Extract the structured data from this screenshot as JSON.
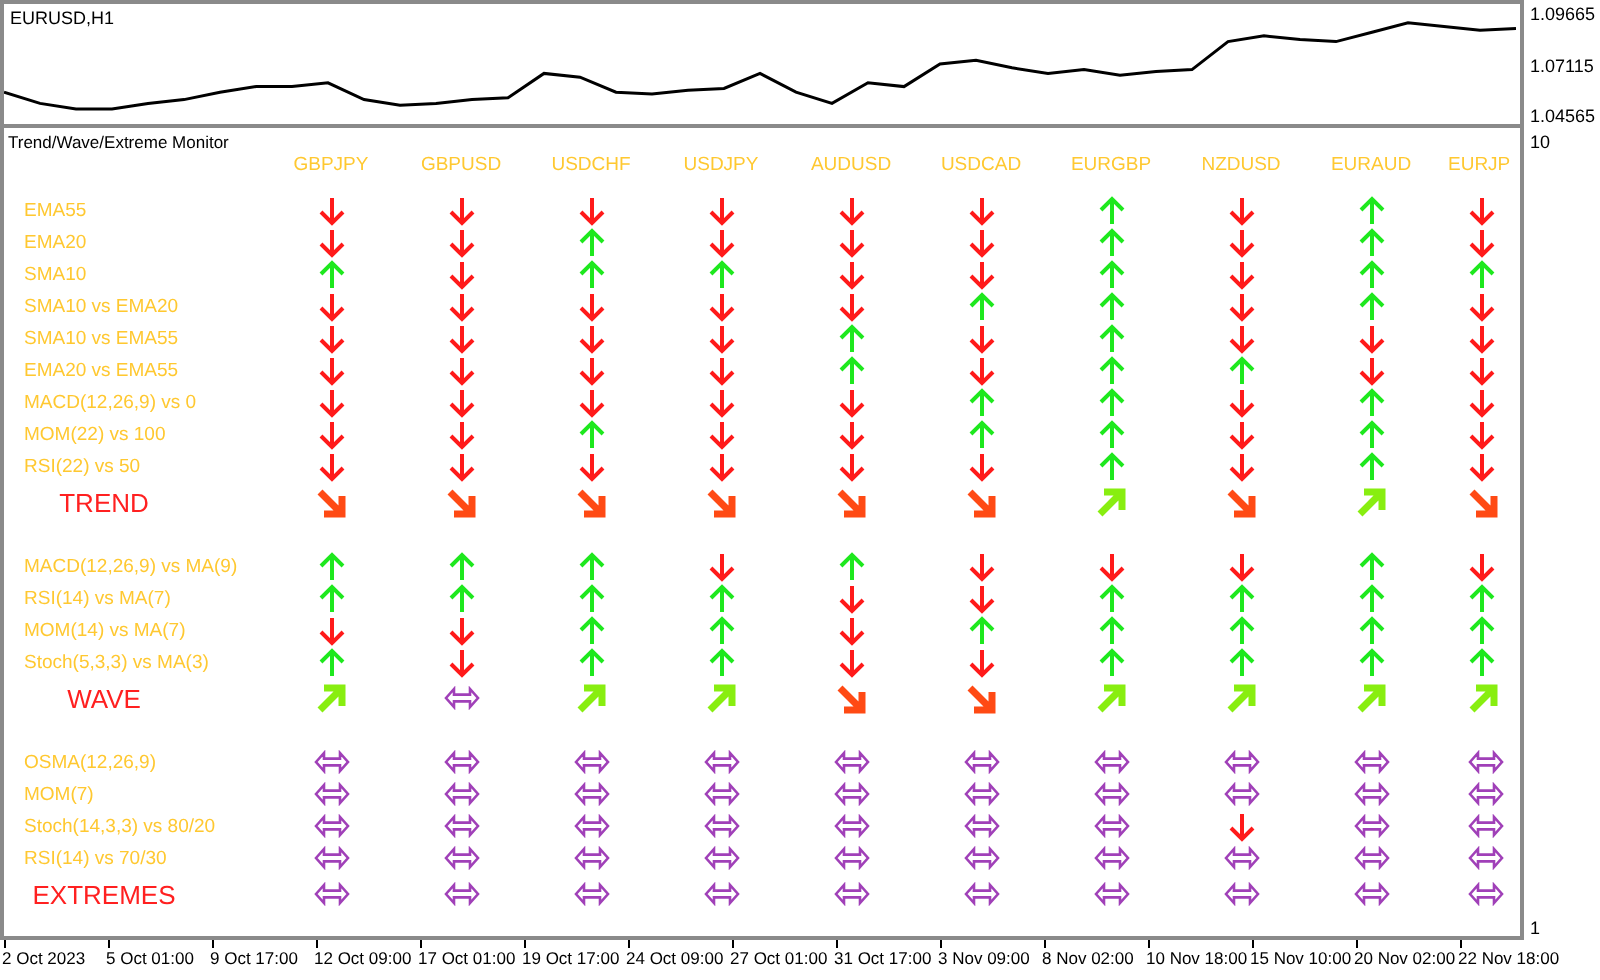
{
  "chart": {
    "title": "EURUSD,H1",
    "chart_data": {
      "type": "line",
      "ylim": [
        1.04,
        1.104
      ],
      "yticks": [
        1.09665,
        1.07115,
        1.04565
      ],
      "series": [
        {
          "color": "#000000",
          "values": [
            1.057,
            1.051,
            1.048,
            1.048,
            1.051,
            1.053,
            1.057,
            1.06,
            1.06,
            1.062,
            1.053,
            1.05,
            1.051,
            1.053,
            1.054,
            1.067,
            1.065,
            1.057,
            1.056,
            1.058,
            1.059,
            1.067,
            1.057,
            1.051,
            1.062,
            1.06,
            1.072,
            1.074,
            1.07,
            1.067,
            1.069,
            1.066,
            1.068,
            1.069,
            1.084,
            1.087,
            1.085,
            1.084,
            1.089,
            1.094,
            1.092,
            1.09,
            1.091
          ]
        }
      ]
    }
  },
  "monitor": {
    "title": "Trend/Wave/Extreme Monitor",
    "scale_labels": [
      "10",
      "1"
    ],
    "symbols": [
      "GBPJPY",
      "GBPUSD",
      "USDCHF",
      "USDJPY",
      "AUDUSD",
      "USDCAD",
      "EURGBP",
      "NZDUSD",
      "EURAUD",
      "EURJP"
    ],
    "sections": [
      {
        "rows": [
          {
            "label": "EMA55",
            "signals": [
              {
                "kind": "down"
              },
              {
                "kind": "down"
              },
              {
                "kind": "down"
              },
              {
                "kind": "down"
              },
              {
                "kind": "down"
              },
              {
                "kind": "down"
              },
              {
                "kind": "up"
              },
              {
                "kind": "down"
              },
              {
                "kind": "up"
              },
              {
                "kind": "down"
              }
            ]
          },
          {
            "label": "EMA20",
            "signals": [
              {
                "kind": "down"
              },
              {
                "kind": "down"
              },
              {
                "kind": "up"
              },
              {
                "kind": "down"
              },
              {
                "kind": "down"
              },
              {
                "kind": "down"
              },
              {
                "kind": "up"
              },
              {
                "kind": "down"
              },
              {
                "kind": "up"
              },
              {
                "kind": "down"
              }
            ]
          },
          {
            "label": "SMA10",
            "signals": [
              {
                "kind": "up"
              },
              {
                "kind": "down"
              },
              {
                "kind": "up"
              },
              {
                "kind": "up"
              },
              {
                "kind": "down"
              },
              {
                "kind": "down"
              },
              {
                "kind": "up"
              },
              {
                "kind": "down"
              },
              {
                "kind": "up"
              },
              {
                "kind": "up"
              }
            ]
          },
          {
            "label": "SMA10 vs EMA20",
            "signals": [
              {
                "kind": "down"
              },
              {
                "kind": "down"
              },
              {
                "kind": "down"
              },
              {
                "kind": "down"
              },
              {
                "kind": "down"
              },
              {
                "kind": "up"
              },
              {
                "kind": "up"
              },
              {
                "kind": "down"
              },
              {
                "kind": "up"
              },
              {
                "kind": "down"
              }
            ]
          },
          {
            "label": "SMA10 vs EMA55",
            "signals": [
              {
                "kind": "down"
              },
              {
                "kind": "down"
              },
              {
                "kind": "down"
              },
              {
                "kind": "down"
              },
              {
                "kind": "up"
              },
              {
                "kind": "down"
              },
              {
                "kind": "up"
              },
              {
                "kind": "down"
              },
              {
                "kind": "down"
              },
              {
                "kind": "down"
              }
            ]
          },
          {
            "label": "EMA20 vs EMA55",
            "signals": [
              {
                "kind": "down"
              },
              {
                "kind": "down"
              },
              {
                "kind": "down"
              },
              {
                "kind": "down"
              },
              {
                "kind": "up"
              },
              {
                "kind": "down"
              },
              {
                "kind": "up"
              },
              {
                "kind": "up"
              },
              {
                "kind": "down"
              },
              {
                "kind": "down"
              }
            ]
          },
          {
            "label": "MACD(12,26,9) vs 0",
            "signals": [
              {
                "kind": "down"
              },
              {
                "kind": "down"
              },
              {
                "kind": "down"
              },
              {
                "kind": "down"
              },
              {
                "kind": "down"
              },
              {
                "kind": "up"
              },
              {
                "kind": "up"
              },
              {
                "kind": "down"
              },
              {
                "kind": "up"
              },
              {
                "kind": "down"
              }
            ]
          },
          {
            "label": "MOM(22) vs 100",
            "signals": [
              {
                "kind": "down"
              },
              {
                "kind": "down"
              },
              {
                "kind": "up"
              },
              {
                "kind": "down"
              },
              {
                "kind": "down"
              },
              {
                "kind": "up"
              },
              {
                "kind": "up"
              },
              {
                "kind": "down"
              },
              {
                "kind": "up"
              },
              {
                "kind": "down"
              }
            ]
          },
          {
            "label": "RSI(22) vs 50",
            "signals": [
              {
                "kind": "down"
              },
              {
                "kind": "down"
              },
              {
                "kind": "down"
              },
              {
                "kind": "down"
              },
              {
                "kind": "down"
              },
              {
                "kind": "down"
              },
              {
                "kind": "up"
              },
              {
                "kind": "down"
              },
              {
                "kind": "up"
              },
              {
                "kind": "down"
              }
            ]
          }
        ],
        "summary": {
          "label": "TREND",
          "signals": [
            {
              "kind": "strong-down"
            },
            {
              "kind": "strong-down"
            },
            {
              "kind": "strong-down"
            },
            {
              "kind": "strong-down"
            },
            {
              "kind": "strong-down"
            },
            {
              "kind": "strong-down"
            },
            {
              "kind": "strong-up"
            },
            {
              "kind": "strong-down"
            },
            {
              "kind": "strong-up"
            },
            {
              "kind": "strong-down"
            }
          ]
        }
      },
      {
        "rows": [
          {
            "label": "MACD(12,26,9) vs MA(9)",
            "signals": [
              {
                "kind": "up"
              },
              {
                "kind": "up"
              },
              {
                "kind": "up"
              },
              {
                "kind": "down"
              },
              {
                "kind": "up"
              },
              {
                "kind": "down"
              },
              {
                "kind": "down"
              },
              {
                "kind": "down"
              },
              {
                "kind": "up"
              },
              {
                "kind": "down"
              }
            ]
          },
          {
            "label": "RSI(14) vs MA(7)",
            "signals": [
              {
                "kind": "up"
              },
              {
                "kind": "up"
              },
              {
                "kind": "up"
              },
              {
                "kind": "up"
              },
              {
                "kind": "down"
              },
              {
                "kind": "down"
              },
              {
                "kind": "up"
              },
              {
                "kind": "up"
              },
              {
                "kind": "up"
              },
              {
                "kind": "up"
              }
            ]
          },
          {
            "label": "MOM(14) vs MA(7)",
            "signals": [
              {
                "kind": "down"
              },
              {
                "kind": "down"
              },
              {
                "kind": "up"
              },
              {
                "kind": "up"
              },
              {
                "kind": "down"
              },
              {
                "kind": "up"
              },
              {
                "kind": "up"
              },
              {
                "kind": "up"
              },
              {
                "kind": "up"
              },
              {
                "kind": "up"
              }
            ]
          },
          {
            "label": "Stoch(5,3,3) vs MA(3)",
            "signals": [
              {
                "kind": "up"
              },
              {
                "kind": "down"
              },
              {
                "kind": "up"
              },
              {
                "kind": "up"
              },
              {
                "kind": "down"
              },
              {
                "kind": "down"
              },
              {
                "kind": "up"
              },
              {
                "kind": "up"
              },
              {
                "kind": "up"
              },
              {
                "kind": "up"
              }
            ]
          }
        ],
        "summary": {
          "label": "WAVE",
          "signals": [
            {
              "kind": "strong-up"
            },
            {
              "kind": "neutral"
            },
            {
              "kind": "strong-up"
            },
            {
              "kind": "strong-up"
            },
            {
              "kind": "strong-down"
            },
            {
              "kind": "strong-down"
            },
            {
              "kind": "strong-up"
            },
            {
              "kind": "strong-up"
            },
            {
              "kind": "strong-up"
            },
            {
              "kind": "strong-up"
            }
          ]
        }
      },
      {
        "rows": [
          {
            "label": "OSMA(12,26,9)",
            "signals": [
              {
                "kind": "neutral"
              },
              {
                "kind": "neutral"
              },
              {
                "kind": "neutral"
              },
              {
                "kind": "neutral"
              },
              {
                "kind": "neutral"
              },
              {
                "kind": "neutral"
              },
              {
                "kind": "neutral"
              },
              {
                "kind": "neutral"
              },
              {
                "kind": "neutral"
              },
              {
                "kind": "neutral"
              }
            ]
          },
          {
            "label": "MOM(7)",
            "signals": [
              {
                "kind": "neutral"
              },
              {
                "kind": "neutral"
              },
              {
                "kind": "neutral"
              },
              {
                "kind": "neutral"
              },
              {
                "kind": "neutral"
              },
              {
                "kind": "neutral"
              },
              {
                "kind": "neutral"
              },
              {
                "kind": "neutral"
              },
              {
                "kind": "neutral"
              },
              {
                "kind": "neutral"
              }
            ]
          },
          {
            "label": "Stoch(14,3,3) vs 80/20",
            "signals": [
              {
                "kind": "neutral"
              },
              {
                "kind": "neutral"
              },
              {
                "kind": "neutral"
              },
              {
                "kind": "neutral"
              },
              {
                "kind": "neutral"
              },
              {
                "kind": "neutral"
              },
              {
                "kind": "neutral"
              },
              {
                "kind": "down"
              },
              {
                "kind": "neutral"
              },
              {
                "kind": "neutral"
              }
            ]
          },
          {
            "label": "RSI(14) vs 70/30",
            "signals": [
              {
                "kind": "neutral"
              },
              {
                "kind": "neutral"
              },
              {
                "kind": "neutral"
              },
              {
                "kind": "neutral"
              },
              {
                "kind": "neutral"
              },
              {
                "kind": "neutral"
              },
              {
                "kind": "neutral"
              },
              {
                "kind": "neutral"
              },
              {
                "kind": "neutral"
              },
              {
                "kind": "neutral"
              }
            ]
          }
        ],
        "summary": {
          "label": "EXTREMES",
          "signals": [
            {
              "kind": "neutral"
            },
            {
              "kind": "neutral"
            },
            {
              "kind": "neutral"
            },
            {
              "kind": "neutral"
            },
            {
              "kind": "neutral"
            },
            {
              "kind": "neutral"
            },
            {
              "kind": "neutral"
            },
            {
              "kind": "neutral"
            },
            {
              "kind": "neutral"
            },
            {
              "kind": "neutral"
            }
          ]
        }
      }
    ]
  },
  "time_axis": [
    "2 Oct 2023",
    "5 Oct 01:00",
    "9 Oct 17:00",
    "12 Oct 09:00",
    "17 Oct 01:00",
    "19 Oct 17:00",
    "24 Oct 09:00",
    "27 Oct 01:00",
    "31 Oct 17:00",
    "3 Nov 09:00",
    "8 Nov 02:00",
    "10 Nov 18:00",
    "15 Nov 10:00",
    "20 Nov 02:00",
    "22 Nov 18:00"
  ]
}
